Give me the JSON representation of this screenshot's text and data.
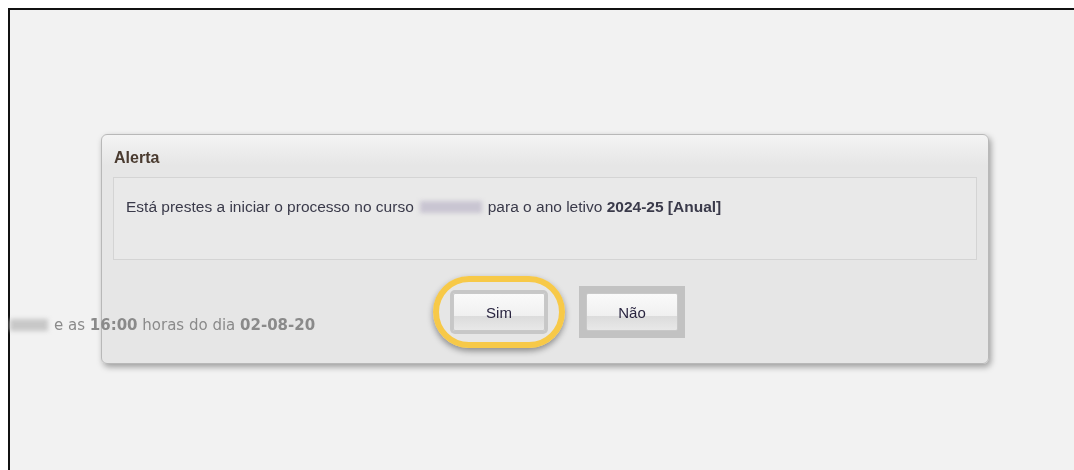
{
  "dialog": {
    "title": "Alerta",
    "message": "Está prestes a iniciar o processo no curso",
    "message_after": "para o ano letivo **2024-25 [Anual]**",
    "buttons": [
      {
        "label": "Sim",
        "highlighted": true
      },
      {
        "label": "Não",
        "highlighted": false
      }
    ]
  },
  "background_text": "e as **16:00** horas do dia **02-08-20**"
}
